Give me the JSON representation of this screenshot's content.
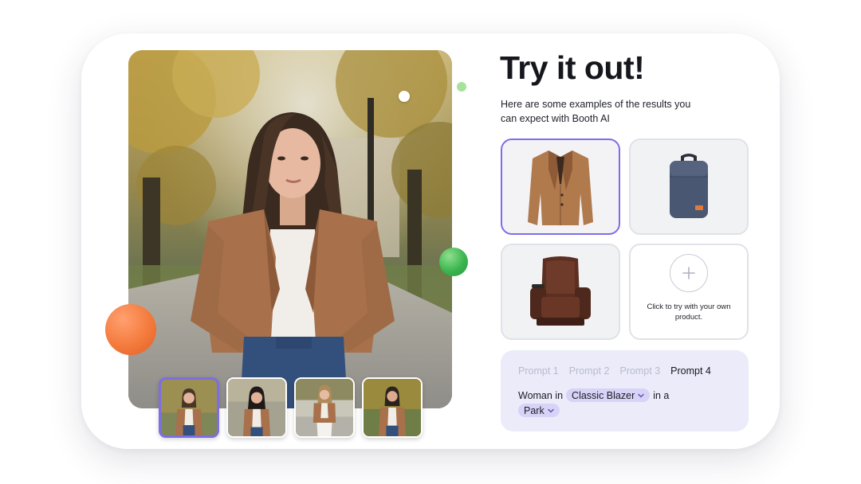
{
  "heading": {
    "title": "Try it out!",
    "subtitle": "Here are some examples of the results you can expect with Booth AI"
  },
  "products": [
    {
      "name": "blazer",
      "icon": "blazer-image",
      "selected": true
    },
    {
      "name": "backpack",
      "icon": "backpack-image",
      "selected": false
    },
    {
      "name": "recliner",
      "icon": "recliner-image",
      "selected": false
    }
  ],
  "add_product": {
    "label": "Click to try with your own product.",
    "icon": "plus-icon"
  },
  "prompts": {
    "tabs": [
      "Prompt 1",
      "Prompt 2",
      "Prompt 3",
      "Prompt 4"
    ],
    "active_tab": "Prompt 4",
    "sentence": {
      "prefix": "Woman in",
      "item_value": "Classic Blazer",
      "connector": "in a",
      "location_value": "Park"
    }
  },
  "thumbnails": [
    {
      "name": "result-1",
      "selected": true
    },
    {
      "name": "result-2",
      "selected": false
    },
    {
      "name": "result-3",
      "selected": false
    },
    {
      "name": "result-4",
      "selected": false
    }
  ],
  "colors": {
    "accent": "#7c6ee6",
    "prompt_bg": "#ebebfa",
    "chip_bg": "#d6d3f7",
    "orange_ball": "#f47a3c",
    "green_ball": "#3bb54f"
  }
}
